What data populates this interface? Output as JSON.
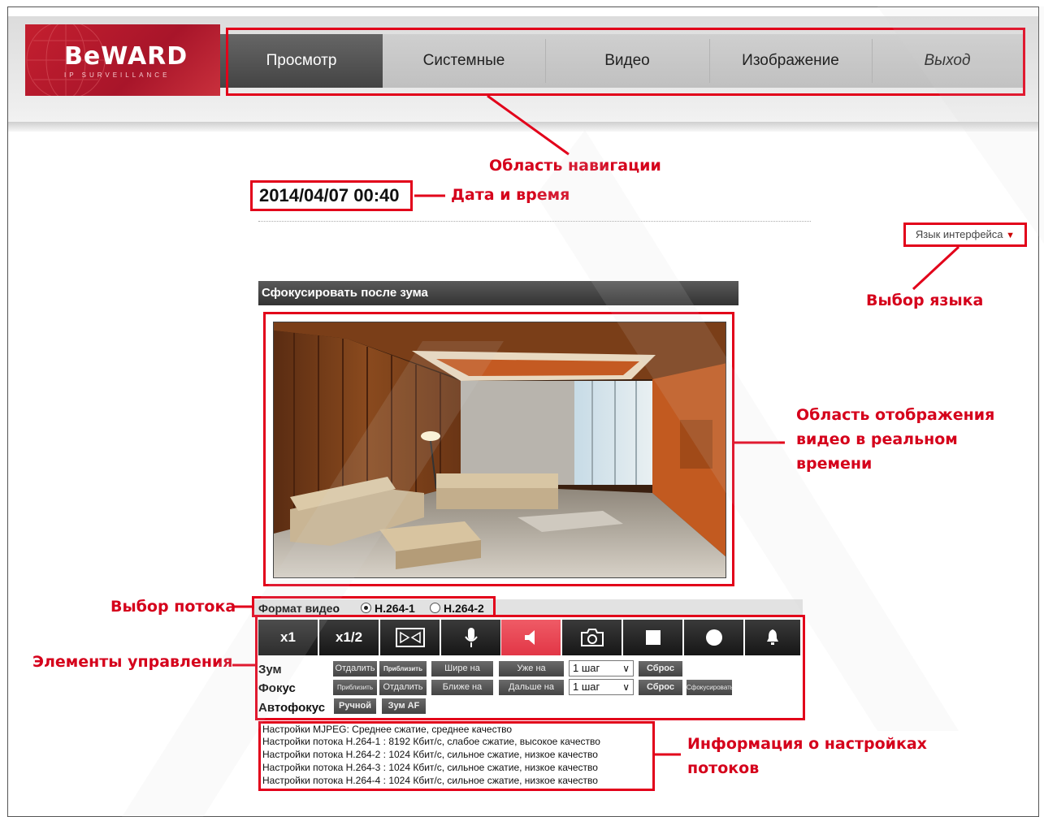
{
  "logo": {
    "name": "BeWARD",
    "tagline": "IP SURVEILLANCE"
  },
  "nav": {
    "items": [
      {
        "label": "Просмотр",
        "active": true
      },
      {
        "label": "Системные"
      },
      {
        "label": "Видео"
      },
      {
        "label": "Изображение"
      },
      {
        "label": "Выход"
      }
    ]
  },
  "datetime": "2014/04/07 00:40",
  "language_select": {
    "label": "Язык интерфейса",
    "arrow": "▼"
  },
  "panel_title": "Сфокусировать после зума",
  "stream": {
    "label": "Формат видео",
    "options": [
      {
        "label": "H.264-1",
        "selected": true
      },
      {
        "label": "H.264-2",
        "selected": false
      }
    ]
  },
  "toolbar": {
    "buttons": [
      {
        "label": "x1",
        "icon": ""
      },
      {
        "label": "x1/2",
        "icon": ""
      },
      {
        "label": "",
        "icon": "fullscreen-icon"
      },
      {
        "label": "",
        "icon": "microphone-icon"
      },
      {
        "label": "",
        "icon": "speaker-icon",
        "active": true
      },
      {
        "label": "",
        "icon": "camera-icon"
      },
      {
        "label": "",
        "icon": "stop-icon"
      },
      {
        "label": "",
        "icon": "record-icon"
      },
      {
        "label": "",
        "icon": "bell-icon"
      }
    ]
  },
  "zoom": {
    "label": "Зум",
    "btn_out": "Отдалить",
    "btn_in": "Приблизить",
    "btn_wide": "Шире на",
    "btn_narrow": "Уже на",
    "step": "1 шаг",
    "reset": "Сброс"
  },
  "focus": {
    "label": "Фокус",
    "btn_in": "Приблизить",
    "btn_out": "Отдалить",
    "btn_near": "Ближе на",
    "btn_far": "Дальше на",
    "step": "1 шаг",
    "reset": "Сброс",
    "focus_btn": "Сфокусировать"
  },
  "autofocus": {
    "label": "Автофокус",
    "manual": "Ручной",
    "zoom_af": "Зум AF"
  },
  "stream_info": [
    "Настройки MJPEG: Среднее сжатие, среднее качество",
    "Настройки потока H.264-1 : 8192 Кбит/с, слабое сжатие, высокое качество",
    "Настройки потока H.264-2 : 1024 Кбит/с, сильное сжатие, низкое качество",
    "Настройки потока H.264-3 : 1024 Кбит/с, сильное сжатие, низкое качество",
    "Настройки потока H.264-4 : 1024 Кбит/с, сильное сжатие, низкое качество"
  ],
  "annotations": {
    "nav_area": "Область навигации",
    "datetime": "Дата и время",
    "language": "Выбор языка",
    "video_area_1": "Область отображения",
    "video_area_2": "видео в реальном",
    "video_area_3": "времени",
    "stream_select": "Выбор потока",
    "controls": "Элементы управления",
    "stream_info_1": "Информация о настройках",
    "stream_info_2": "потоков"
  },
  "colors": {
    "annotation_red": "#e2001a",
    "brand_red": "#c41f2f"
  }
}
